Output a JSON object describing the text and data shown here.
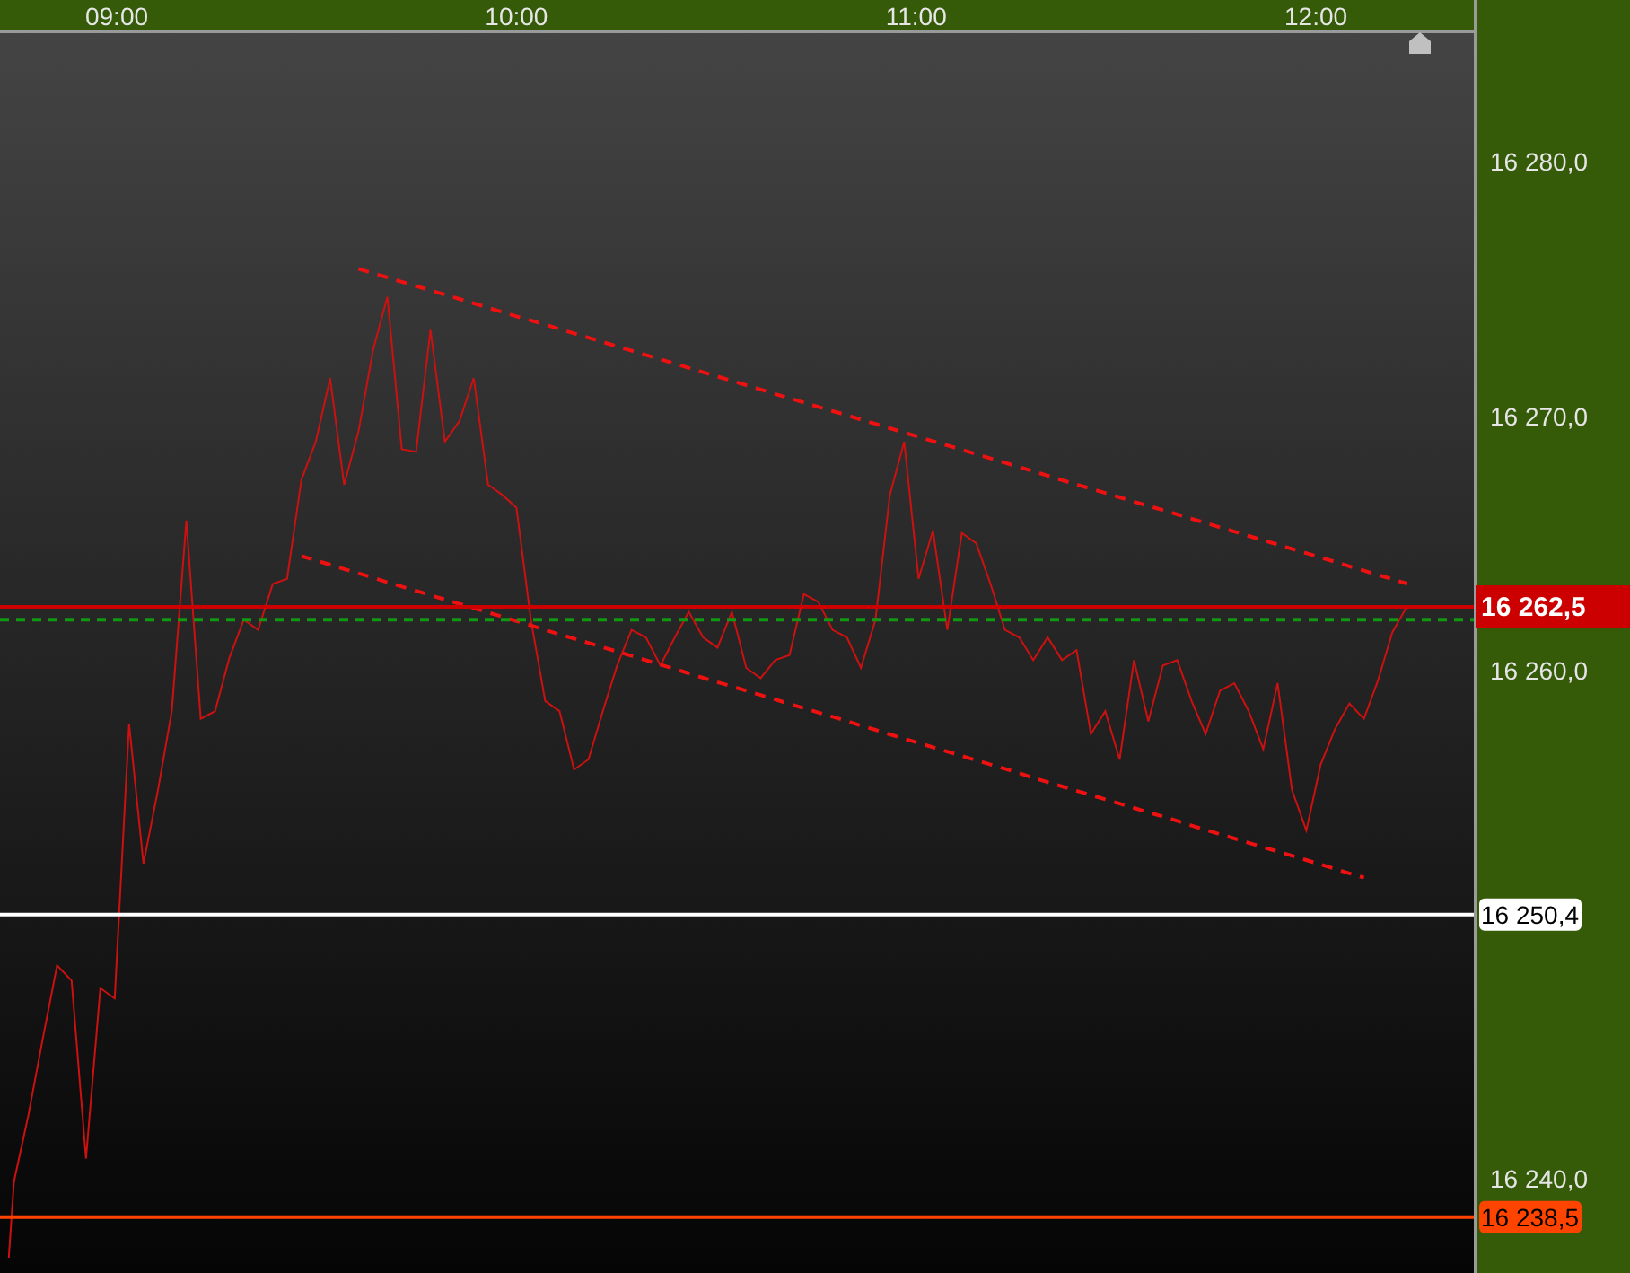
{
  "chart": {
    "chart_data": {
      "type": "line",
      "x": [
        8.73,
        8.743,
        8.779,
        8.815,
        8.851,
        8.887,
        8.923,
        8.959,
        8.995,
        9.031,
        9.067,
        9.103,
        9.138,
        9.174,
        9.21,
        9.246,
        9.282,
        9.318,
        9.354,
        9.39,
        9.426,
        9.462,
        9.498,
        9.534,
        9.569,
        9.605,
        9.641,
        9.677,
        9.713,
        9.749,
        9.785,
        9.821,
        9.857,
        9.893,
        9.929,
        9.965,
        10.0,
        10.036,
        10.072,
        10.108,
        10.144,
        10.18,
        10.216,
        10.252,
        10.288,
        10.324,
        10.36,
        10.396,
        10.431,
        10.467,
        10.503,
        10.539,
        10.575,
        10.611,
        10.647,
        10.683,
        10.719,
        10.755,
        10.791,
        10.827,
        10.862,
        10.898,
        10.934,
        10.97,
        11.006,
        11.042,
        11.078,
        11.114,
        11.15,
        11.186,
        11.222,
        11.258,
        11.293,
        11.329,
        11.365,
        11.401,
        11.437,
        11.473,
        11.509,
        11.545,
        11.581,
        11.617,
        11.653,
        11.689,
        11.724,
        11.76,
        11.796,
        11.832,
        11.868,
        11.904,
        11.94,
        11.976,
        12.012,
        12.048,
        12.084,
        12.12,
        12.155,
        12.191,
        12.227
      ],
      "series": [
        {
          "color": "#cc1111",
          "line_style": "solid",
          "values": [
            16236.9,
            16239.9,
            16242.5,
            16245.5,
            16248.4,
            16247.8,
            16240.8,
            16247.5,
            16247.1,
            16257.9,
            16252.4,
            16255.3,
            16258.4,
            16265.9,
            16258.1,
            16258.4,
            16260.5,
            16262.0,
            16261.6,
            16263.4,
            16263.6,
            16267.5,
            16269.0,
            16271.5,
            16267.3,
            16269.4,
            16272.6,
            16274.7,
            16268.7,
            16268.6,
            16273.4,
            16269.0,
            16269.8,
            16271.5,
            16267.3,
            16266.9,
            16266.4,
            16262.0,
            16258.8,
            16258.4,
            16256.1,
            16256.5,
            16258.4,
            16260.2,
            16261.6,
            16261.3,
            16260.2,
            16261.3,
            16262.3,
            16261.3,
            16260.9,
            16262.3,
            16260.1,
            16259.7,
            16260.4,
            16260.6,
            16263.0,
            16262.7,
            16261.6,
            16261.3,
            16260.1,
            16262.0,
            16266.9,
            16269.0,
            16263.6,
            16265.5,
            16261.6,
            16265.4,
            16265.0,
            16263.4,
            16261.6,
            16261.3,
            16260.4,
            16261.3,
            16260.4,
            16260.8,
            16257.5,
            16258.4,
            16256.5,
            16260.4,
            16258.0,
            16260.2,
            16260.4,
            16258.8,
            16257.5,
            16259.2,
            16259.5,
            16258.4,
            16256.9,
            16259.5,
            16255.3,
            16253.7,
            16256.3,
            16257.7,
            16258.7,
            16258.1,
            16259.6,
            16261.5,
            16262.5
          ]
        },
        {
          "color": "#ee1111",
          "line_style": "dashed",
          "values": [
            null,
            null,
            null,
            null,
            null,
            null,
            null,
            null,
            null,
            null,
            null,
            null,
            null,
            null,
            null,
            null,
            null,
            null,
            null,
            null,
            null,
            null,
            null,
            null,
            null,
            16275.8,
            16275.63,
            16275.46,
            16275.29,
            16275.12,
            16274.95,
            16274.78,
            16274.61,
            16274.44,
            16274.27,
            16274.1,
            16273.93,
            16273.77,
            16273.6,
            16273.43,
            16273.26,
            16273.09,
            16272.92,
            16272.75,
            16272.58,
            16272.41,
            16272.24,
            16272.07,
            16271.9,
            16271.73,
            16271.56,
            16271.39,
            16271.22,
            16271.05,
            16270.88,
            16270.71,
            16270.54,
            16270.37,
            16270.2,
            16270.04,
            16269.87,
            16269.7,
            16269.53,
            16269.36,
            16269.19,
            16269.02,
            16268.85,
            16268.68,
            16268.51,
            16268.34,
            16268.17,
            16268.0,
            16267.83,
            16267.66,
            16267.49,
            16267.32,
            16267.15,
            16266.98,
            16266.81,
            16266.64,
            16266.47,
            16266.31,
            16266.14,
            16265.97,
            16265.8,
            16265.63,
            16265.46,
            16265.29,
            16265.12,
            16264.95,
            16264.78,
            16264.61,
            16264.44,
            16264.27,
            16264.1,
            16263.93,
            16263.76,
            16263.59,
            16263.42
          ]
        },
        {
          "color": "#ee1111",
          "line_style": "dashed",
          "values": [
            null,
            null,
            null,
            null,
            null,
            null,
            null,
            null,
            null,
            null,
            null,
            null,
            null,
            null,
            null,
            null,
            null,
            null,
            null,
            null,
            null,
            16264.5,
            16264.33,
            16264.16,
            16263.99,
            16263.82,
            16263.65,
            16263.47,
            16263.3,
            16263.13,
            16262.96,
            16262.79,
            16262.62,
            16262.45,
            16262.28,
            16262.11,
            16261.94,
            16261.77,
            16261.59,
            16261.42,
            16261.25,
            16261.08,
            16260.91,
            16260.74,
            16260.57,
            16260.4,
            16260.23,
            16260.06,
            16259.89,
            16259.71,
            16259.54,
            16259.37,
            16259.2,
            16259.03,
            16258.86,
            16258.69,
            16258.52,
            16258.35,
            16258.18,
            16258.01,
            16257.83,
            16257.66,
            16257.49,
            16257.32,
            16257.15,
            16256.98,
            16256.81,
            16256.64,
            16256.47,
            16256.3,
            16256.13,
            16255.96,
            16255.78,
            16255.61,
            16255.44,
            16255.27,
            16255.1,
            16254.93,
            16254.76,
            16254.59,
            16254.42,
            16254.25,
            16254.08,
            16253.9,
            16253.73,
            16253.56,
            16253.39,
            16253.22,
            16253.05,
            16252.88,
            16252.71,
            16252.54,
            16252.37,
            16252.2,
            16252.02,
            16251.85,
            null,
            null,
            null
          ]
        }
      ],
      "xlim": [
        8.708,
        12.395
      ],
      "ylim": [
        16236.3,
        16285.1
      ],
      "xticks": [
        {
          "value": 9,
          "label": "09:00"
        },
        {
          "value": 10,
          "label": "10:00"
        },
        {
          "value": 11,
          "label": "11:00"
        },
        {
          "value": 12,
          "label": "12:00"
        }
      ],
      "yticks": [
        {
          "value": 16280,
          "label": "16 280,0"
        },
        {
          "value": 16270,
          "label": "16 270,0"
        },
        {
          "value": 16260,
          "label": "16 260,0"
        },
        {
          "value": 16240,
          "label": "16 240,0"
        }
      ],
      "ref_lines": [
        {
          "axis": "y",
          "value": 16262.0,
          "color": "#119911"
        },
        {
          "axis": "y",
          "value": 16262.5,
          "color": "#cc0000",
          "label": "16 262,5"
        },
        {
          "axis": "y",
          "value": 16250.4,
          "color": "#ffffff",
          "label": "16 250,4"
        },
        {
          "axis": "y",
          "value": 16238.5,
          "color": "#ff4400",
          "label": "16 238,5"
        }
      ]
    }
  }
}
